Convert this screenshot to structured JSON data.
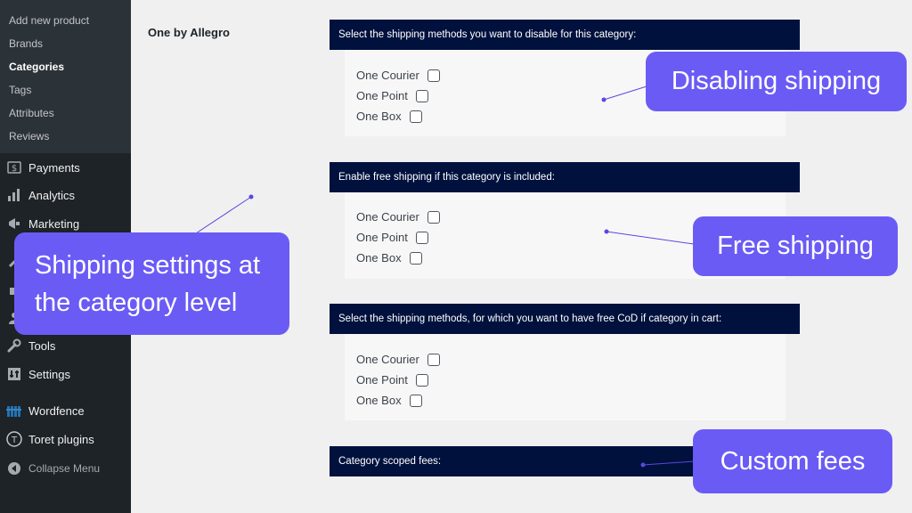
{
  "sidebar": {
    "submenu": [
      {
        "label": "Add new product"
      },
      {
        "label": "Brands"
      },
      {
        "label": "Categories",
        "current": true
      },
      {
        "label": "Tags"
      },
      {
        "label": "Attributes"
      },
      {
        "label": "Reviews"
      }
    ],
    "menu": [
      {
        "label": "Payments",
        "icon": "dollar-icon"
      },
      {
        "label": "Analytics",
        "icon": "bar-chart-icon"
      },
      {
        "label": "Marketing",
        "icon": "megaphone-icon"
      },
      {
        "label": "Tools",
        "icon": "wrench-icon"
      },
      {
        "label": "Settings",
        "icon": "settings-icon"
      },
      {
        "label": "Wordfence",
        "icon": "wordfence-icon"
      },
      {
        "label": "Toret plugins",
        "icon": "toret-icon"
      },
      {
        "label": "Collapse Menu",
        "icon": "collapse-icon"
      }
    ]
  },
  "main": {
    "section_label": "One by Allegro",
    "boxes": [
      {
        "header": "Select the shipping methods you want to disable for this category:",
        "options": [
          "One Courier",
          "One Point",
          "One Box"
        ]
      },
      {
        "header": "Enable free shipping if this category is included:",
        "options": [
          "One Courier",
          "One Point",
          "One Box"
        ]
      },
      {
        "header": "Select the shipping methods, for which you want to have free CoD if category in cart:",
        "options": [
          "One Courier",
          "One Point",
          "One Box"
        ]
      },
      {
        "header": "Category scoped fees:",
        "options": []
      }
    ]
  },
  "callouts": {
    "disabling": "Disabling shipping",
    "free": "Free shipping",
    "category_level": "Shipping settings at the category level",
    "fees": "Custom fees"
  },
  "colors": {
    "header_bg": "#00113d",
    "callout_bg": "#6b5bf5",
    "sidebar_bg": "#1d2327"
  }
}
